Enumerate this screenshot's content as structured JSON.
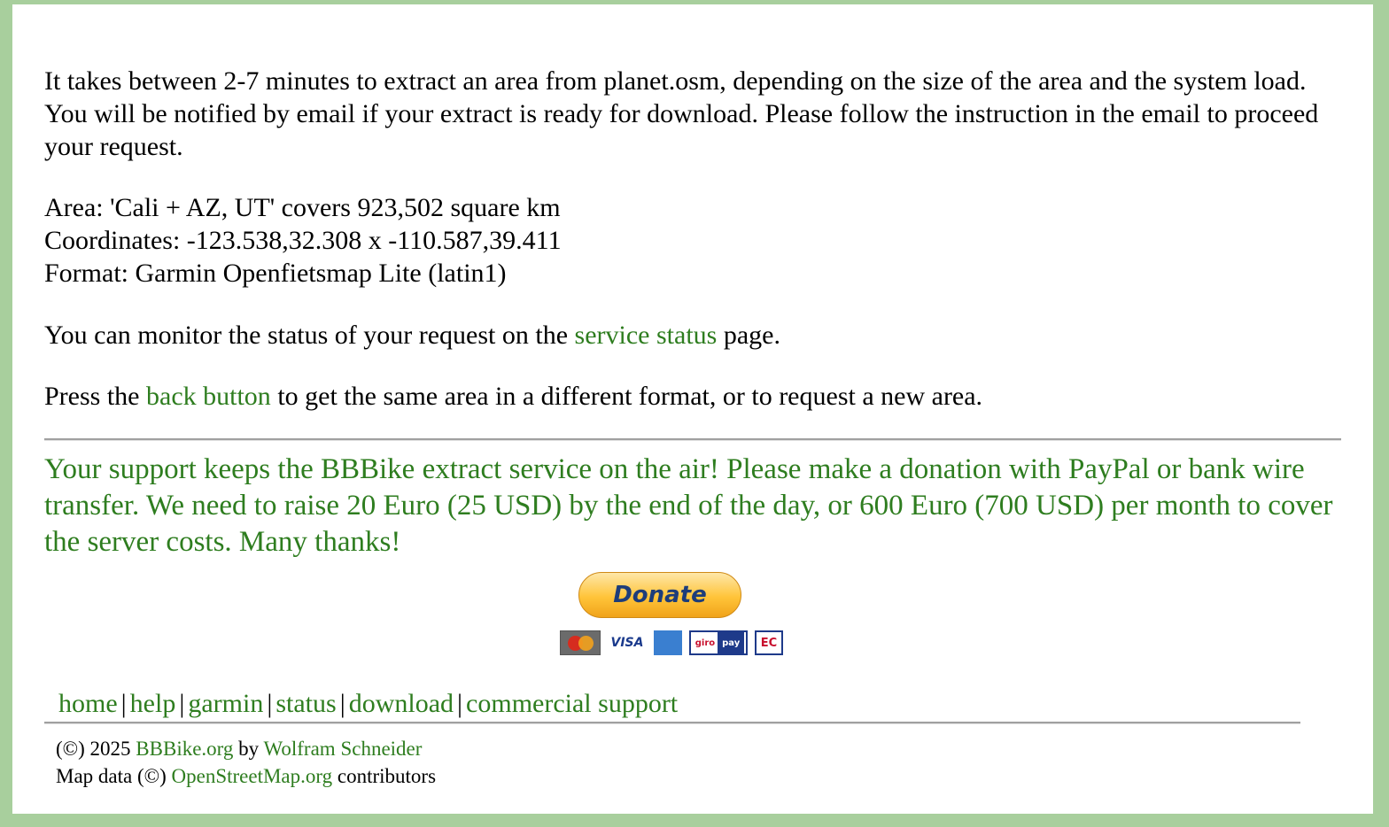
{
  "intro": {
    "text": "It takes between 2-7 minutes to extract an area from planet.osm, depending on the size of the area and the system load. You will be notified by email if your extract is ready for download. Please follow the instruction in the email to proceed your request."
  },
  "details": {
    "area": "Area: 'Cali + AZ, UT' covers 923,502 square km",
    "coordinates": "Coordinates: -123.538,32.308 x -110.587,39.411",
    "format": "Format: Garmin Openfietsmap Lite (latin1)"
  },
  "monitor": {
    "prefix": "You can monitor the status of your request on the ",
    "link": "service status",
    "suffix": " page."
  },
  "back": {
    "prefix": "Press the ",
    "link": "back button",
    "suffix": " to get the same area in a different format, or to request a new area."
  },
  "support": {
    "text": "Your support keeps the BBBike extract service on the air! Please make a donation with PayPal or bank wire transfer. We need to raise 20 Euro (25 USD) by the end of the day, or 600 Euro (700 USD) per month to cover the server costs. Many thanks!"
  },
  "donate": {
    "label": "Donate",
    "cards": {
      "mastercard_text": "MasterCard",
      "visa_text": "VISA",
      "amex_text": "AMERICAN EXPRESS",
      "giro_text": "giro",
      "pay_text": "pay",
      "ec_text": "EC"
    }
  },
  "nav": {
    "items": [
      "home",
      "help",
      "garmin",
      "status",
      "download",
      "commercial support"
    ],
    "separator": "|"
  },
  "footer": {
    "copy_prefix": "(©) 2025 ",
    "site_link": "BBBike.org",
    "by": " by ",
    "author_link": "Wolfram Schneider",
    "map_prefix": "Map data (©) ",
    "osm_link": "OpenStreetMap.org",
    "map_suffix": " contributors"
  },
  "colors": {
    "link": "#2e7d1f",
    "frame": "#a8cf9d"
  }
}
